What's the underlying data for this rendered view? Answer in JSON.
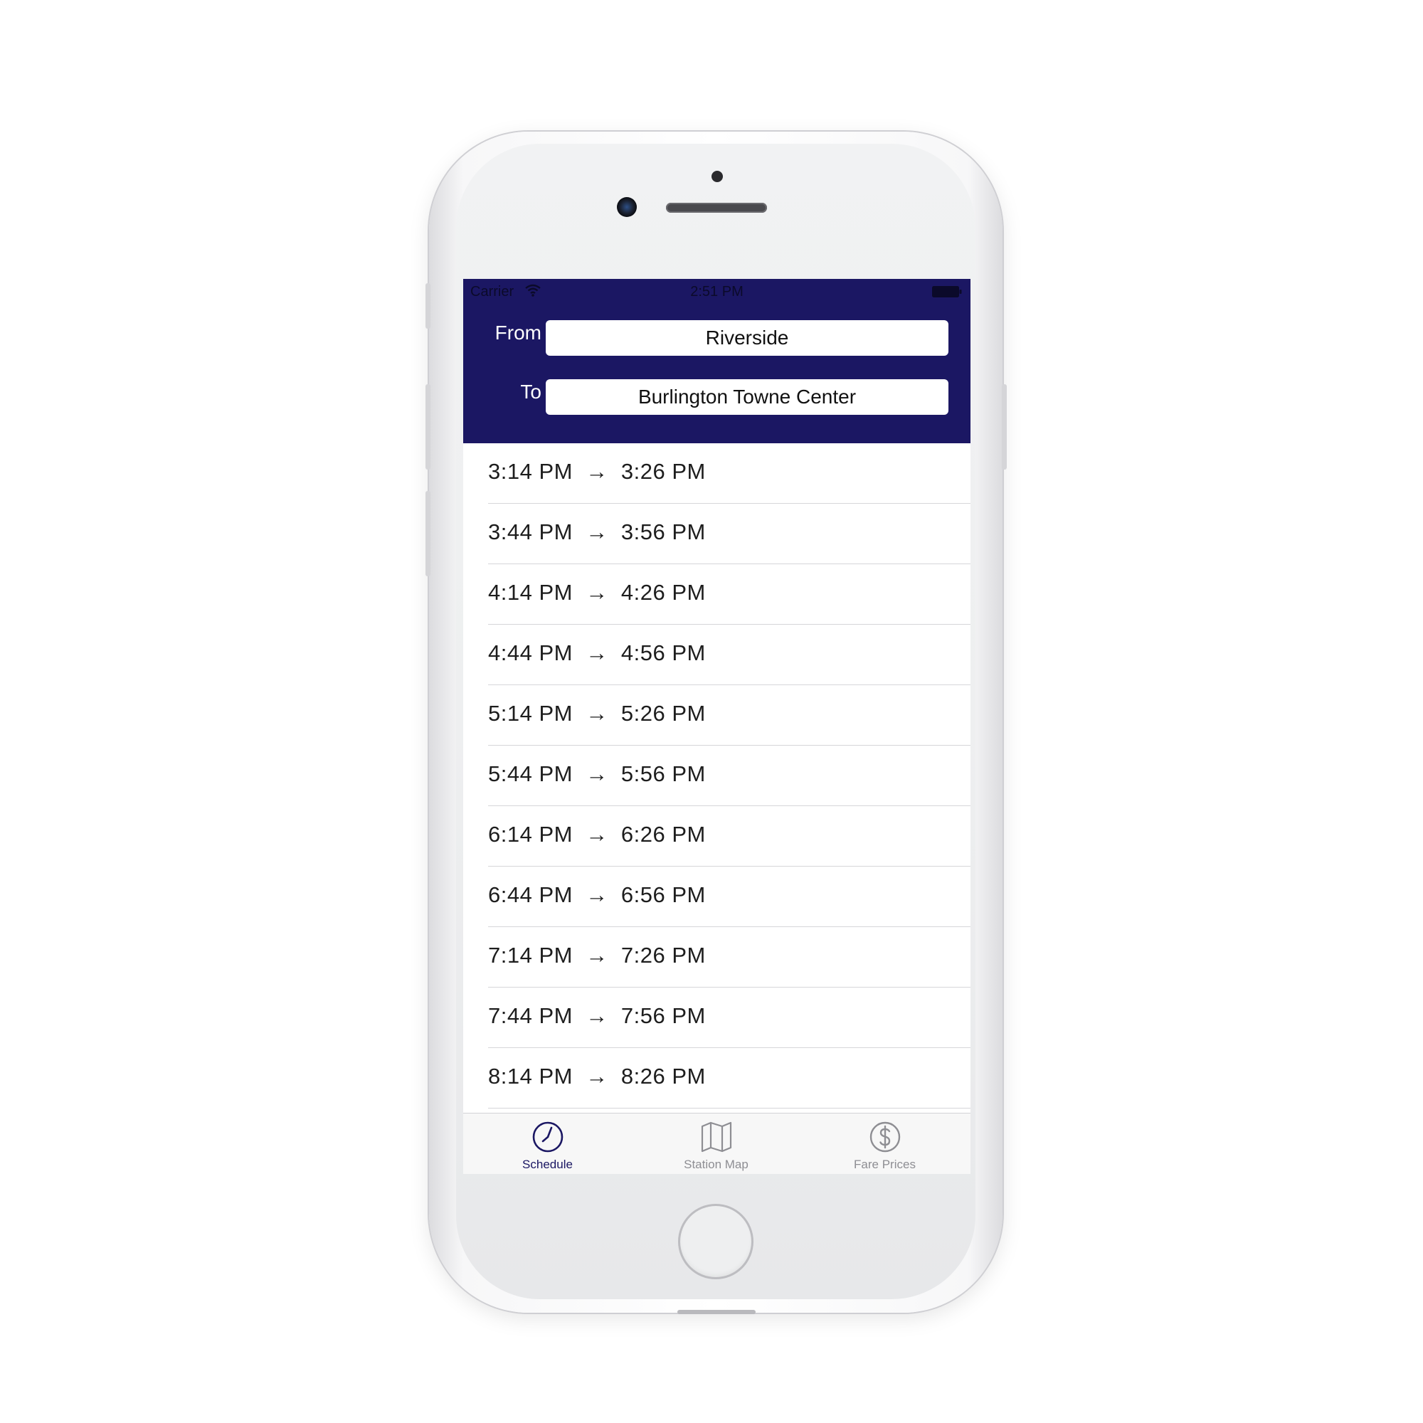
{
  "status_bar": {
    "carrier": "Carrier",
    "time": "2:51 PM"
  },
  "route": {
    "from_label": "From",
    "from_value": "Riverside",
    "to_label": "To",
    "to_value": "Burlington Towne Center"
  },
  "trips": [
    "3:14 PM  →  3:26 PM",
    "3:44 PM  →  3:56 PM",
    "4:14 PM  →  4:26 PM",
    "4:44 PM  →  4:56 PM",
    "5:14 PM  →  5:26 PM",
    "5:44 PM  →  5:56 PM",
    "6:14 PM  →  6:26 PM",
    "6:44 PM  →  6:56 PM",
    "7:14 PM  →  7:26 PM",
    "7:44 PM  →  7:56 PM",
    "8:14 PM  →  8:26 PM"
  ],
  "tabs": [
    {
      "label": "Schedule",
      "icon": "clock-icon",
      "active": true
    },
    {
      "label": "Station Map",
      "icon": "map-icon",
      "active": false
    },
    {
      "label": "Fare Prices",
      "icon": "dollar-icon",
      "active": false
    }
  ],
  "colors": {
    "accent": "#1b1763",
    "inactive": "#8e8e93"
  }
}
